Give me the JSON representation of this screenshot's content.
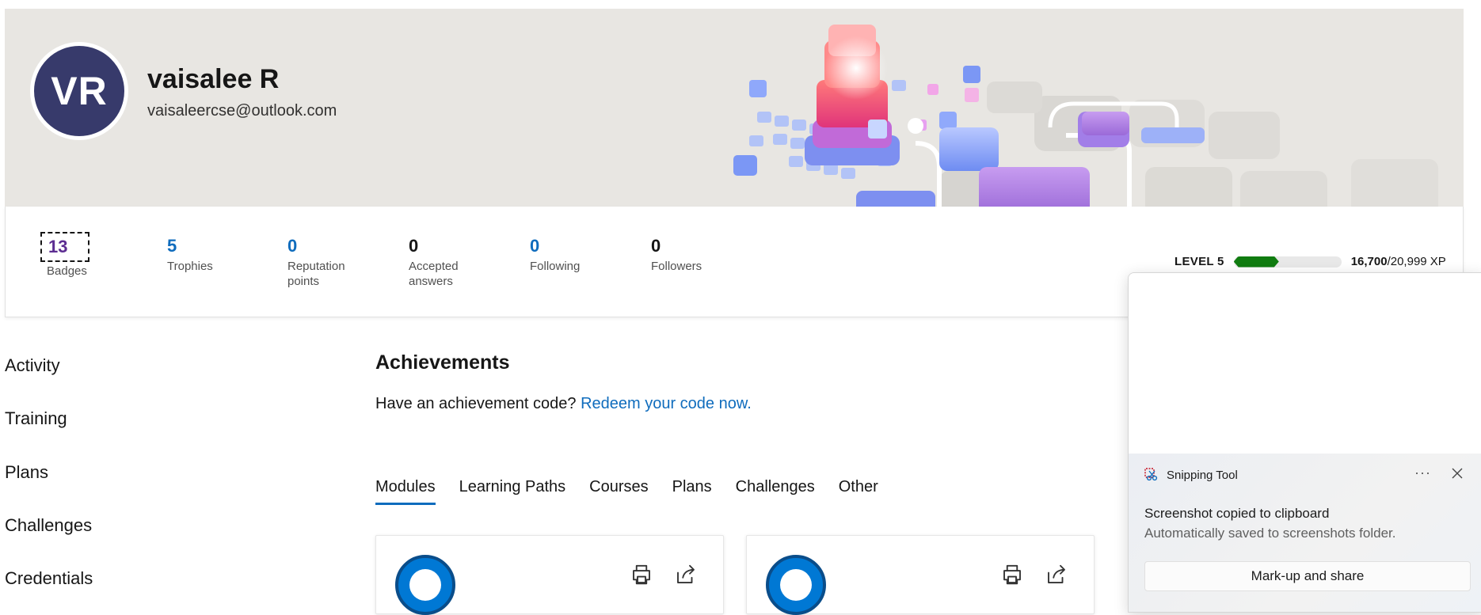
{
  "profile": {
    "initials": "VR",
    "name": "vaisalee R",
    "email": "vaisaleercse@outlook.com"
  },
  "stats": [
    {
      "value": "13",
      "label": "Badges"
    },
    {
      "value": "5",
      "label": "Trophies"
    },
    {
      "value": "0",
      "label": "Reputation points"
    },
    {
      "value": "0",
      "label": "Accepted answers"
    },
    {
      "value": "0",
      "label": "Following"
    },
    {
      "value": "0",
      "label": "Followers"
    }
  ],
  "level": {
    "label": "LEVEL 5",
    "xp_current": "16,700",
    "xp_total": "/20,999 XP",
    "progress_fraction": 0.42,
    "progress_color": "#107c10"
  },
  "sidebar": {
    "items": [
      "Activity",
      "Training",
      "Plans",
      "Challenges",
      "Credentials"
    ]
  },
  "achievements": {
    "title": "Achievements",
    "prompt": "Have an achievement code?",
    "link": "Redeem your code now."
  },
  "tabs": [
    "Modules",
    "Learning Paths",
    "Courses",
    "Plans",
    "Challenges",
    "Other"
  ],
  "cards": [
    {
      "icon": "module-badge-icon",
      "actions": [
        "print-icon",
        "share-icon"
      ]
    },
    {
      "icon": "module-badge-icon",
      "actions": [
        "print-icon",
        "share-icon"
      ]
    }
  ],
  "toast": {
    "app_name": "Snipping Tool",
    "more": "···",
    "title": "Screenshot copied to clipboard",
    "subtitle": "Automatically saved to screenshots folder.",
    "button": "Mark-up and share"
  },
  "colors": {
    "accent": "#0f6cbd",
    "avatar": "#373a6b",
    "badges_value": "#5c2d91"
  }
}
